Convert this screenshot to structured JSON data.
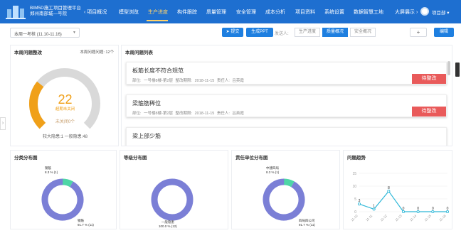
{
  "header": {
    "app_title_line1": "BIM5D施工项目管理平台",
    "app_title_line2": "郑州南部城—号院",
    "back_label": "项目概况",
    "nav": [
      "模型浏览",
      "生产进度",
      "构件跟踪",
      "质量管理",
      "安全管理",
      "成本分析",
      "项目资料",
      "系统设置",
      "数据智慧工地"
    ],
    "active_nav": "生产进度",
    "screen_label": "大屏展示",
    "user_name": "项目部"
  },
  "toolbar": {
    "week_select": "本周一考核 (11.10-11.16)",
    "send_button": "提交",
    "ppt_button": "生成PPT",
    "send_to_label": "发送人:",
    "tabs": [
      "生产进度",
      "质量概况",
      "安全概况"
    ],
    "active_tab": "质量概况",
    "add_button": "+",
    "edit_button": "编辑"
  },
  "gauge_panel": {
    "title": "本周问题整改",
    "meta": "本周问题问题: 12个",
    "value": "22",
    "value_label": "超期未关闭",
    "closed_label": "未关闭0个",
    "legend": "较大隐患:1   一般隐患:48",
    "fraction": 0.31,
    "colors": {
      "fill": "#f0a019",
      "track": "#d9d9d9"
    }
  },
  "issues_panel": {
    "title": "本周问题列表",
    "items": [
      {
        "title": "板筋长度不符合规范",
        "meta": "部位: 一号楼8楼-第2层    整改期限: 2018-11-15    责任人: 吕英霞",
        "status": "待整改"
      },
      {
        "title": "梁箍筋稀位",
        "meta": "部位: 一号楼8楼-第2层    整改期限: 2018-11-15    责任人: 吕英霞",
        "status": "待整改"
      },
      {
        "title": "梁上部少筋",
        "meta": "",
        "status": ""
      }
    ]
  },
  "category_panel": {
    "title": "分类分布图",
    "labels": [
      {
        "name": "钢筋",
        "value": "8.3 % (1)"
      },
      {
        "name": "钢筋",
        "value": "91.7 % (11)"
      }
    ],
    "fractions": [
      0.083,
      0.917
    ],
    "colors": [
      "#4ed6a6",
      "#7b7fd6"
    ]
  },
  "level_panel": {
    "title": "等级分布图",
    "labels": [
      {
        "name": "一般隐患",
        "value": "100.0 % (12)"
      }
    ],
    "fractions": [
      1.0
    ],
    "colors": [
      "#7b7fd6"
    ]
  },
  "unit_panel": {
    "title": "责任单位分布图",
    "labels": [
      {
        "name": "中建四局",
        "value": "8.3 % (1)"
      },
      {
        "name": "四局四公司",
        "value": "91.7 % (11)"
      }
    ],
    "fractions": [
      0.083,
      0.917
    ],
    "colors": [
      "#4ed6a6",
      "#7b7fd6"
    ]
  },
  "trend_panel": {
    "title": "问题趋势",
    "chart_data": {
      "type": "line",
      "x": [
        "11-10",
        "11-11",
        "11-12",
        "11-13",
        "11-14",
        "11-15",
        "11-16"
      ],
      "values": [
        3,
        1,
        8,
        0,
        0,
        0,
        0
      ],
      "yticks": [
        "0",
        "5",
        "10",
        "15"
      ],
      "ylim": [
        0,
        15
      ],
      "color": "#2fb8d8"
    }
  }
}
